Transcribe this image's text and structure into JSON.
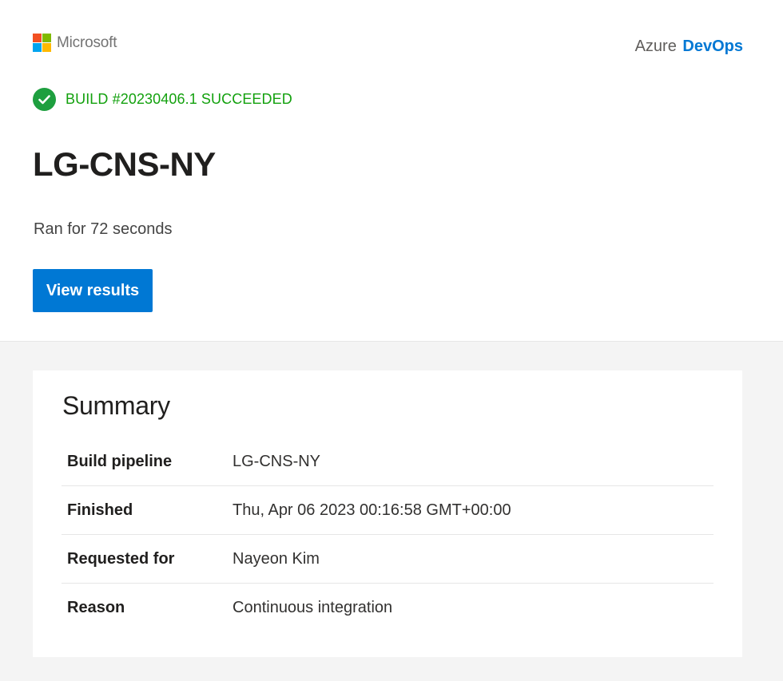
{
  "header": {
    "ms_logo_text": "Microsoft",
    "brand_prefix": "Azure",
    "brand_name": "DevOps",
    "ms_colors": [
      "#f25022",
      "#7fba00",
      "#00a4ef",
      "#ffb900"
    ]
  },
  "build": {
    "status_text": "BUILD #20230406.1 SUCCEEDED",
    "status_icon": "checkmark-circle-icon",
    "status_color": "#13a10e",
    "pipeline_title": "LG-CNS-NY",
    "duration_text": "Ran for 72 seconds",
    "view_results_label": "View results",
    "accent_color": "#0078d4"
  },
  "summary": {
    "title": "Summary",
    "rows": [
      {
        "label": "Build pipeline",
        "value": "LG-CNS-NY"
      },
      {
        "label": "Finished",
        "value": "Thu, Apr 06 2023 00:16:58 GMT+00:00"
      },
      {
        "label": "Requested for",
        "value": "Nayeon Kim"
      },
      {
        "label": "Reason",
        "value": "Continuous integration"
      }
    ]
  }
}
